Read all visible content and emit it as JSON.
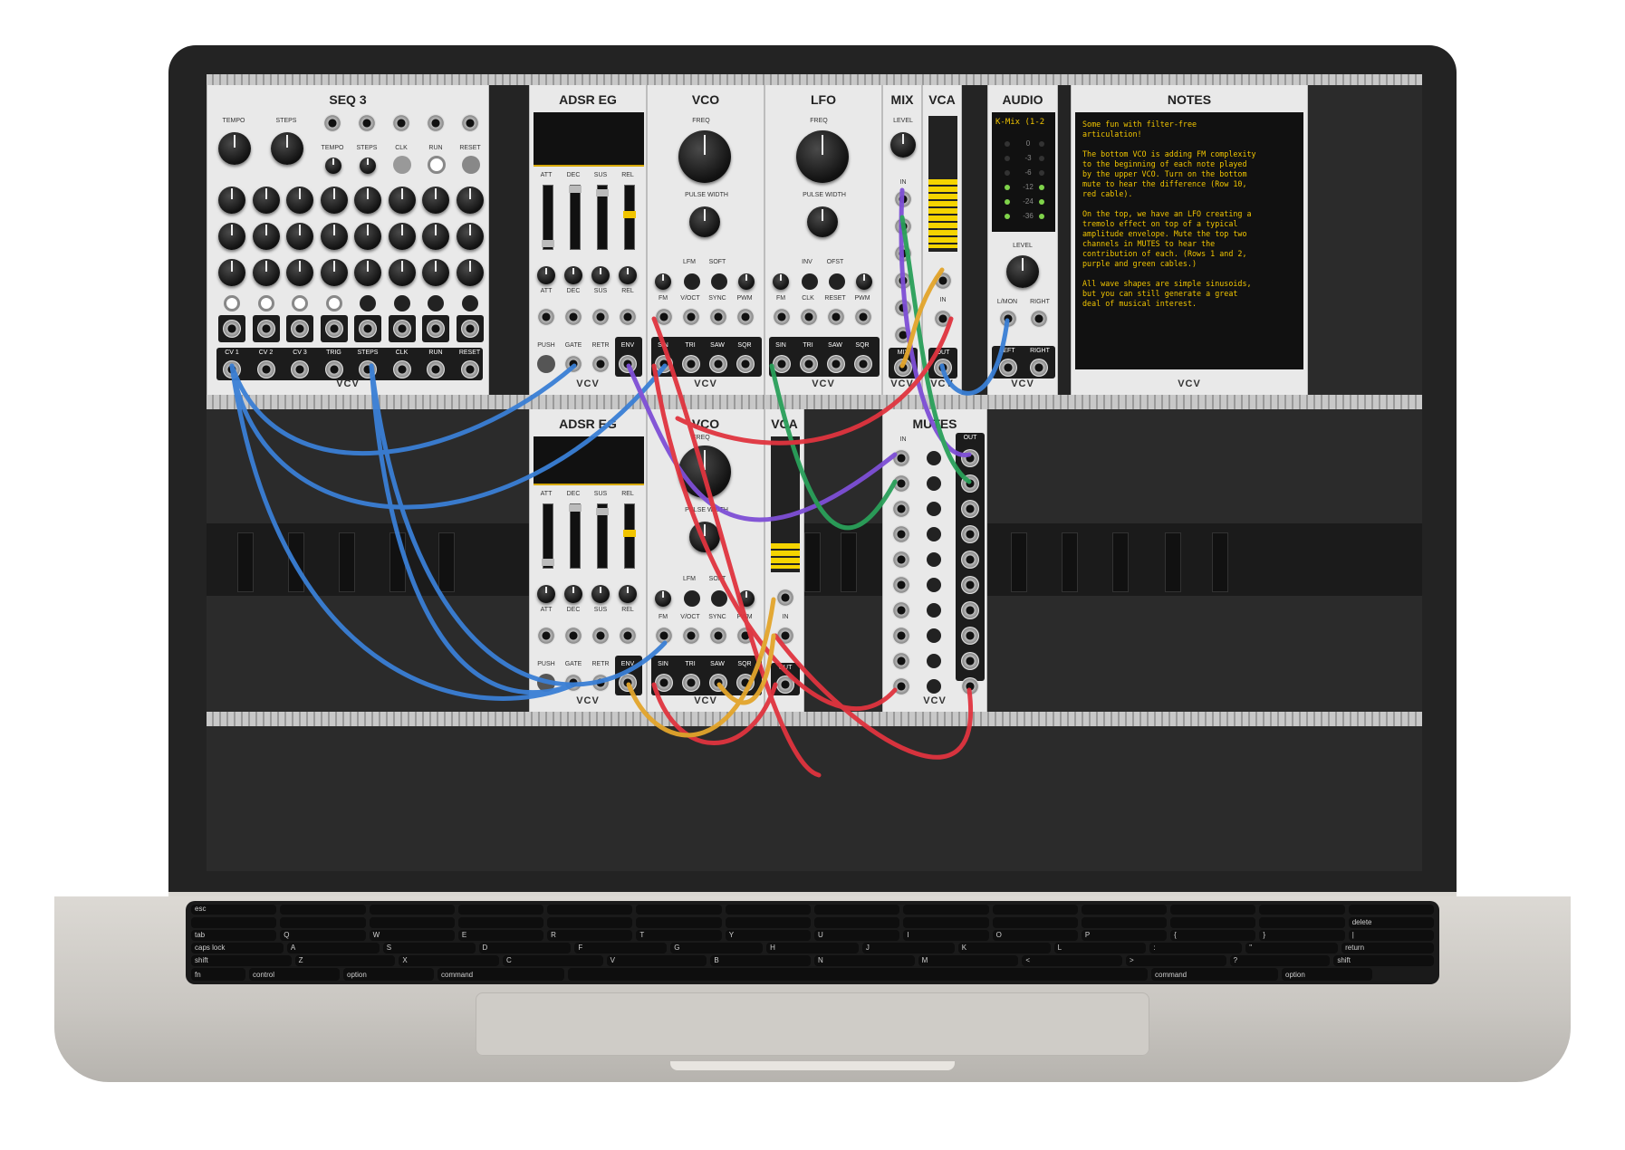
{
  "rack": {
    "row1": {
      "seq3": {
        "title": "SEQ 3",
        "knob_labels": [
          "TEMPO",
          "STEPS"
        ],
        "input_labels": [
          "TEMPO",
          "STEPS",
          "CLK",
          "RUN",
          "RESET"
        ],
        "out_labels": [
          "CV 1",
          "CV 2",
          "CV 3",
          "TRIG",
          "STEPS",
          "CLK",
          "RUN",
          "RESET"
        ],
        "brand": "VCV"
      },
      "adsr1": {
        "title": "ADSR EG",
        "slider_labels": [
          "ATT",
          "DEC",
          "SUS",
          "REL"
        ],
        "jack_labels": [
          "ATT",
          "DEC",
          "SUS",
          "REL"
        ],
        "bottom_labels": [
          "PUSH",
          "GATE",
          "RETR",
          "ENV"
        ],
        "brand": "VCV"
      },
      "vco1": {
        "title": "VCO",
        "freq_label": "FREQ",
        "pw_label": "PULSE WIDTH",
        "switch_labels": [
          "LFM",
          "SOFT"
        ],
        "in_labels": [
          "FM",
          "V/OCT",
          "SYNC",
          "PWM"
        ],
        "out_labels": [
          "SIN",
          "TRI",
          "SAW",
          "SQR"
        ],
        "brand": "VCV"
      },
      "lfo": {
        "title": "LFO",
        "freq_label": "FREQ",
        "pw_label": "PULSE WIDTH",
        "switch_labels": [
          "INV",
          "OFST"
        ],
        "in_labels": [
          "FM",
          "CLK",
          "RESET",
          "PWM"
        ],
        "out_labels": [
          "SIN",
          "TRI",
          "SAW",
          "SQR"
        ],
        "brand": "VCV"
      },
      "mix": {
        "title": "MIX",
        "level_label": "LEVEL",
        "in_label": "IN",
        "out_label": "MIX",
        "brand": "VCV"
      },
      "vca": {
        "title": "VCA",
        "in_label": "IN",
        "out_label": "OUT",
        "brand": "VCV"
      },
      "audio": {
        "title": "AUDIO",
        "device": "K-Mix (1-2",
        "meter": [
          "0",
          "-3",
          "-6",
          "-12",
          "-24",
          "-36"
        ],
        "level_label": "LEVEL",
        "out_labels": [
          "L/MON",
          "RIGHT"
        ],
        "in_labels": [
          "LEFT",
          "RIGHT"
        ],
        "brand": "VCV"
      },
      "notes": {
        "title": "NOTES",
        "text": "Some fun with filter-free\narticulation!\n\nThe bottom VCO is adding FM complexity\nto the beginning of each note played\nby the upper VCO. Turn on the bottom\nmute to hear the difference (Row 10,\nred cable).\n\nOn the top, we have an LFO creating a\ntremolo effect on top of a typical\namplitude envelope. Mute the top two\nchannels in MUTES to hear the\ncontribution of each. (Rows 1 and 2,\npurple and green cables.)\n\nAll wave shapes are simple sinusoids,\nbut you can still generate a great\ndeal of musical interest.",
        "brand": "VCV"
      }
    },
    "row2": {
      "adsr2": {
        "title": "ADSR EG",
        "slider_labels": [
          "ATT",
          "DEC",
          "SUS",
          "REL"
        ],
        "jack_labels": [
          "ATT",
          "DEC",
          "SUS",
          "REL"
        ],
        "bottom_labels": [
          "PUSH",
          "GATE",
          "RETR",
          "ENV"
        ],
        "brand": "VCV"
      },
      "vco2": {
        "title": "VCO",
        "freq_label": "FREQ",
        "pw_label": "PULSE WIDTH",
        "switch_labels": [
          "LFM",
          "SOFT"
        ],
        "in_labels": [
          "FM",
          "V/OCT",
          "SYNC",
          "PWM"
        ],
        "out_labels": [
          "SIN",
          "TRI",
          "SAW",
          "SQR"
        ],
        "brand": "VCV"
      },
      "vca2": {
        "title": "VCA",
        "in_label": "IN",
        "out_label": "OUT"
      },
      "mutes": {
        "title": "MUTES",
        "in_label": "IN",
        "out_label": "OUT",
        "brand": "VCV"
      }
    }
  },
  "cable_colors": {
    "blue": "#3a7fd5",
    "purple": "#7e4fd6",
    "green": "#2aa05a",
    "red": "#e0343f",
    "orange": "#e3a52b"
  },
  "keyboard": {
    "row1": [
      "esc",
      "",
      "",
      "",
      "",
      "",
      "",
      "",
      "",
      "",
      "",
      "",
      "",
      ""
    ],
    "row2": [
      "",
      "",
      "",
      "",
      "",
      "",
      "",
      "",
      "",
      "",
      "",
      "",
      "",
      "delete"
    ],
    "row3": [
      "tab",
      "Q",
      "W",
      "E",
      "R",
      "T",
      "Y",
      "U",
      "I",
      "O",
      "P",
      "{",
      "}",
      "|"
    ],
    "row4": [
      "caps lock",
      "A",
      "S",
      "D",
      "F",
      "G",
      "H",
      "J",
      "K",
      "L",
      ":",
      "\"",
      "return"
    ],
    "row5": [
      "shift",
      "Z",
      "X",
      "C",
      "V",
      "B",
      "N",
      "M",
      "<",
      ">",
      "?",
      "shift"
    ],
    "row6": [
      "fn",
      "control",
      "option",
      "command",
      "",
      "command",
      "option"
    ]
  }
}
